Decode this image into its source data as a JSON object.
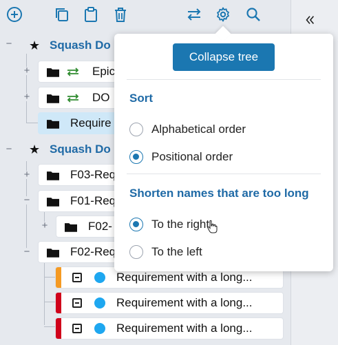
{
  "toolbar": {
    "icons": [
      "add-icon",
      "copy-icon",
      "paste-icon",
      "delete-icon",
      "transfer-icon",
      "settings-icon",
      "search-icon"
    ]
  },
  "side_panel": {
    "collapse_icon": "chevron-double-left-icon"
  },
  "tree": {
    "libraries": [
      {
        "label": "Squash Do",
        "icon": "star-icon"
      },
      {
        "label": "Squash Do",
        "icon": "star-icon"
      }
    ],
    "nodes": [
      {
        "label": "Epic",
        "synced": true
      },
      {
        "label": "DO",
        "synced": true
      },
      {
        "label": "Require",
        "synced": false,
        "selected": true
      },
      {
        "label": "F03-Req",
        "synced": false
      },
      {
        "label": "F01-Req",
        "synced": false
      },
      {
        "label": "F02-",
        "synced": false
      },
      {
        "label": "F02-Req",
        "synced": false
      }
    ],
    "requirements": [
      {
        "label": "Requirement with a long...",
        "criticality_color": "#f59a23",
        "status_color": "#1ea7f0"
      },
      {
        "label": "Requirement with a long...",
        "criticality_color": "#d0021b",
        "status_color": "#1ea7f0"
      },
      {
        "label": "Requirement with a long...",
        "criticality_color": "#d0021b",
        "status_color": "#1ea7f0"
      }
    ]
  },
  "popover": {
    "collapse_button": "Collapse tree",
    "sort_title": "Sort",
    "sort_options": [
      {
        "label": "Alphabetical order",
        "checked": false
      },
      {
        "label": "Positional order",
        "checked": true
      }
    ],
    "shorten_title": "Shorten names that are too long",
    "shorten_options": [
      {
        "label": "To the right",
        "checked": true
      },
      {
        "label": "To the left",
        "checked": false
      }
    ]
  },
  "colors": {
    "accent": "#1b77b1",
    "title_blue": "#1f6aa6",
    "sync_green": "#2e8b2e",
    "selected_bg": "#cfe8f8"
  }
}
